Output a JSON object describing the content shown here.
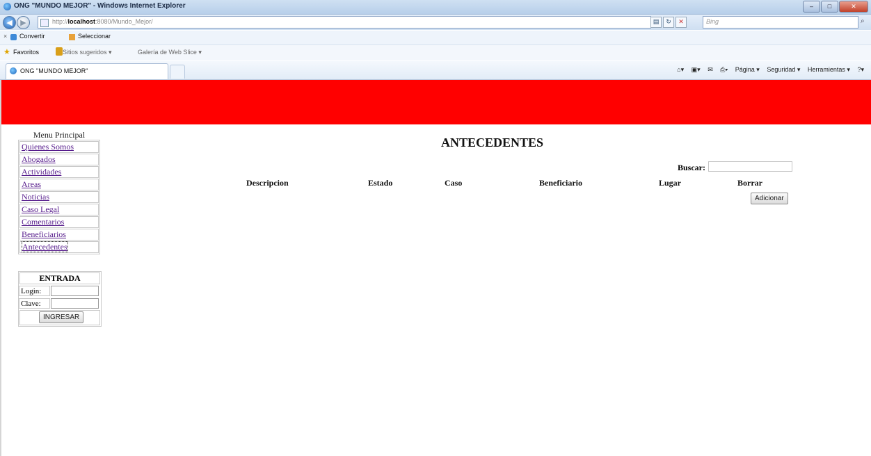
{
  "browser": {
    "window_title": "ONG \"MUNDO MEJOR\" - Windows Internet Explorer",
    "url_prefix": "http://",
    "url_host": "localhost",
    "url_rest": ":8080/Mundo_Mejor/",
    "search_placeholder": "Bing",
    "command_bar": {
      "convert": "Convertir",
      "select": "Seleccionar"
    },
    "favorites": {
      "label": "Favoritos",
      "suggested": "Sitios sugeridos ▾",
      "web_slice": "Galería de Web Slice ▾"
    },
    "tab_title": "ONG \"MUNDO MEJOR\"",
    "toolbar": {
      "page": "Página ▾",
      "security": "Seguridad ▾",
      "tools": "Herramientas ▾"
    }
  },
  "menu": {
    "title": "Menu Principal",
    "items": [
      "Quienes Somos",
      "Abogados",
      "Actividades",
      "Areas",
      "Noticias",
      "Caso Legal",
      "Comentarios",
      "Beneficiarios",
      "Antecedentes"
    ]
  },
  "login": {
    "title": "ENTRADA",
    "login_label": "Login:",
    "password_label": "Clave:",
    "submit_label": "INGRESAR"
  },
  "main": {
    "title": "ANTECEDENTES",
    "search_label": "Buscar:",
    "columns": [
      "Descripcion",
      "Estado",
      "Caso",
      "Beneficiario",
      "Lugar",
      "Borrar"
    ],
    "add_button": "Adicionar"
  },
  "colors": {
    "banner": "#ff0000",
    "visited_link": "#551a8b"
  }
}
